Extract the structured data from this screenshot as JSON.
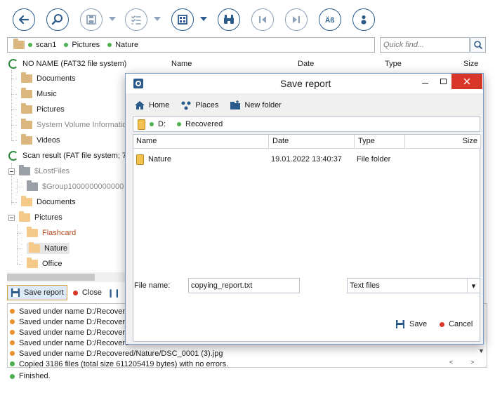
{
  "toolbar": {
    "buttons": [
      {
        "icon": "back-arrow-icon"
      },
      {
        "icon": "search-disk-icon"
      },
      {
        "icon": "save-icon"
      },
      {
        "icon": "checklist-icon"
      },
      {
        "icon": "view-grid-icon"
      },
      {
        "icon": "binoculars-icon"
      },
      {
        "icon": "previous-icon"
      },
      {
        "icon": "next-icon"
      },
      {
        "icon": "case-aa-icon"
      },
      {
        "icon": "settings-icon"
      }
    ]
  },
  "path": {
    "crumbs": [
      "scan1",
      "Pictures",
      "Nature"
    ]
  },
  "quickfind": {
    "placeholder": "Quick find..."
  },
  "tree": {
    "disk1": "NO NAME (FAT32 file system)",
    "disk1_items": [
      "Documents",
      "Music",
      "Pictures",
      "System Volume Information",
      "Videos"
    ],
    "scan": "Scan result (FAT file system; 7",
    "lostfiles": "$LostFiles",
    "group": "$Group1000000000000",
    "documents": "Documents",
    "pictures": "Pictures",
    "flashcard": "Flashcard",
    "nature": "Nature",
    "office": "Office"
  },
  "list_head": {
    "name": "Name",
    "date": "Date",
    "type": "Type",
    "size": "Size"
  },
  "logbar": {
    "save_report": "Save report",
    "close": "Close"
  },
  "log": {
    "rows": [
      "Saved under name D:/Recovere",
      "Saved under name D:/Recovere",
      "Saved under name D:/Recovere",
      "Saved under name D:/Recovere",
      "Saved under name D:/Recovered/Nature/DSC_0001 (3).jpg"
    ],
    "summary": "Copied 3186 files (total size 611205419 bytes) with no errors."
  },
  "status": "Finished.",
  "dialog": {
    "title": "Save report",
    "nav": {
      "home": "Home",
      "places": "Places",
      "new_folder": "New folder"
    },
    "path": {
      "drive": "D:",
      "folder": "Recovered"
    },
    "columns": {
      "name": "Name",
      "date": "Date",
      "type": "Type",
      "size": "Size"
    },
    "rows": [
      {
        "name": "Nature",
        "date": "19.01.2022 13:40:37",
        "type": "File folder"
      }
    ],
    "file_name_label": "File name:",
    "file_name_value": "copying_report.txt",
    "file_type": "Text files",
    "save": "Save",
    "cancel": "Cancel"
  },
  "colors": {
    "accent": "#2a5b8a",
    "close": "#d9362a",
    "ok": "#4caf50",
    "warn": "#e8912d"
  }
}
